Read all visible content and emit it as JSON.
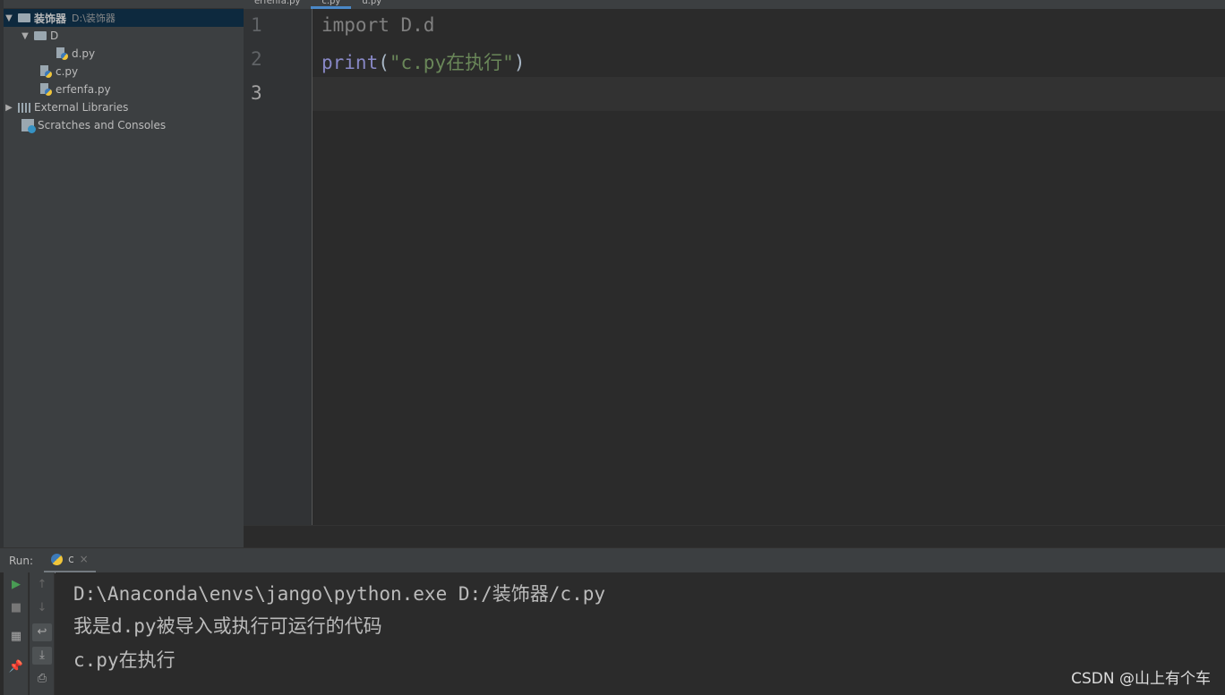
{
  "project": {
    "root": "装饰器",
    "root_path": "D:\\装饰器",
    "items": [
      {
        "label": "D"
      },
      {
        "label": "d.py"
      },
      {
        "label": "c.py"
      },
      {
        "label": "erfenfa.py"
      },
      {
        "label": "External Libraries"
      },
      {
        "label": "Scratches and Consoles"
      }
    ]
  },
  "tabs": [
    {
      "label": "erfenfa.py"
    },
    {
      "label": "c.py",
      "active": true
    },
    {
      "label": "d.py"
    }
  ],
  "editor": {
    "line_numbers": [
      "1",
      "2",
      "3"
    ],
    "line1": "import D.d",
    "line2_fn": "print",
    "line2_open": "(",
    "line2_str": "\"c.py在执行\"",
    "line2_close": ")"
  },
  "run": {
    "label": "Run:",
    "tab": "c",
    "close": "×"
  },
  "console": {
    "lines": [
      "D:\\Anaconda\\envs\\jango\\python.exe D:/装饰器/c.py",
      "我是d.py被导入或执行可运行的代码",
      "c.py在执行"
    ]
  },
  "watermark": "CSDN @山上有个车"
}
